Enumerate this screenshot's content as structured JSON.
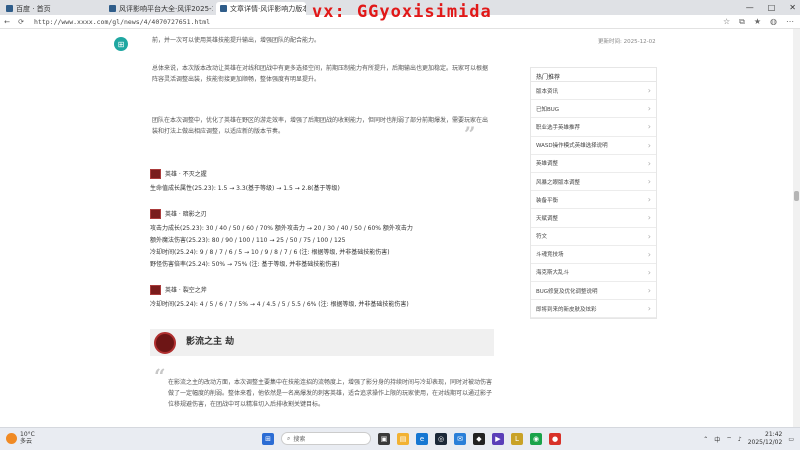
{
  "watermark": "vx: GGyoxisimida",
  "browser": {
    "tabs": [
      {
        "label": "百度 · 首页",
        "active": false
      },
      {
        "label": "风评影响平台大全·风评2025-12",
        "active": false
      },
      {
        "label": "文章详情·风评影响力版本更新·影流之主劫",
        "active": true
      }
    ],
    "url": "http://www.xxxx.com/gl/news/4/4070727651.html",
    "window_controls": [
      "—",
      "□",
      "✕"
    ]
  },
  "article": {
    "top_text": "前，并一次可以使用英雄技能提升输出，增强团队的配合能力。",
    "para1": "总体来说，本次版本改动让英雄在对线和团战中有更多选择空间，前期压制能力有所提升，后期输出也更加稳定。玩家可以根据阵容灵活调整出装，技能衔接更加顺畅，整体强度有明显提升。",
    "para2": "团队在本次调整中，优化了英雄在野区的游走效率，增强了后期团战的收割能力，但同时也削弱了部分前期爆发，需要玩家在出装和打法上做出相应调整，以适应新的版本节奏。",
    "heroes": [
      {
        "name": "英雄 · 不灭之握",
        "lines": [
          "生命值成长属性(25.23): 1.5 → 3.3(基于等级) → 1.5 → 2.8(基于等级)"
        ]
      },
      {
        "name": "英雄 · 暗影之刃",
        "lines": [
          "攻击力成长(25.23): 30 / 40 / 50 / 60 / 70% 额外攻击力 → 20 / 30 / 40 / 50 / 60% 额外攻击力",
          "额外魔法伤害(25.23): 80 / 90 / 100 / 110 → 25 / 50 / 75 / 100 / 125",
          "冷却时间(25.24): 9 / 8 / 7 / 6 / 5 → 10 / 9 / 8 / 7 / 6 (注: 根据等级, 并非基础技能伤害)",
          "野怪伤害倍率(25.24): 50% → 75% (注: 基于等级, 并非基础技能伤害)"
        ]
      },
      {
        "name": "英雄 · 裂空之斧",
        "lines": [
          "冷却时间(25.24): 4 / 5 / 6 / 7 / 5% → 4 / 4.5 / 5 / 5.5 / 6% (注: 根据等级, 并非基础技能伤害)"
        ]
      }
    ],
    "section_title": "影流之主 劫",
    "para3": "在影流之主的改动方面，本次调整主要集中在技能连招的流畅度上，增强了影分身的持续时间与冷却表现，同时对被动伤害做了一定幅度的削弱。整体来看，他依然是一名高爆发的刺客英雄，适合追求操作上限的玩家使用，在对线期可以通过影子位移规避伤害，在团战中可以精准切入后排收割关键目标。"
  },
  "meta": {
    "date": "更新时间: 2025-12-02"
  },
  "sidebar": {
    "heading": "热门推荐",
    "items": [
      "版本资讯",
      "已知BUG",
      "职业选手英雄推荐",
      "WASD操作模式英雄选择说明",
      "英雄调整",
      "风暴之眼版本调整",
      "装备平衡",
      "天赋调整",
      "符文",
      "斗魂竞技场",
      "海克斯大乱斗",
      "BUG修复及优化调整说明",
      "即将到来的新皮肤及炫彩"
    ]
  },
  "taskbar": {
    "weather_temp": "10°C",
    "weather_desc": "多云",
    "search_placeholder": "搜索",
    "time": "21:42",
    "date": "2025/12/02",
    "lang": "中"
  }
}
